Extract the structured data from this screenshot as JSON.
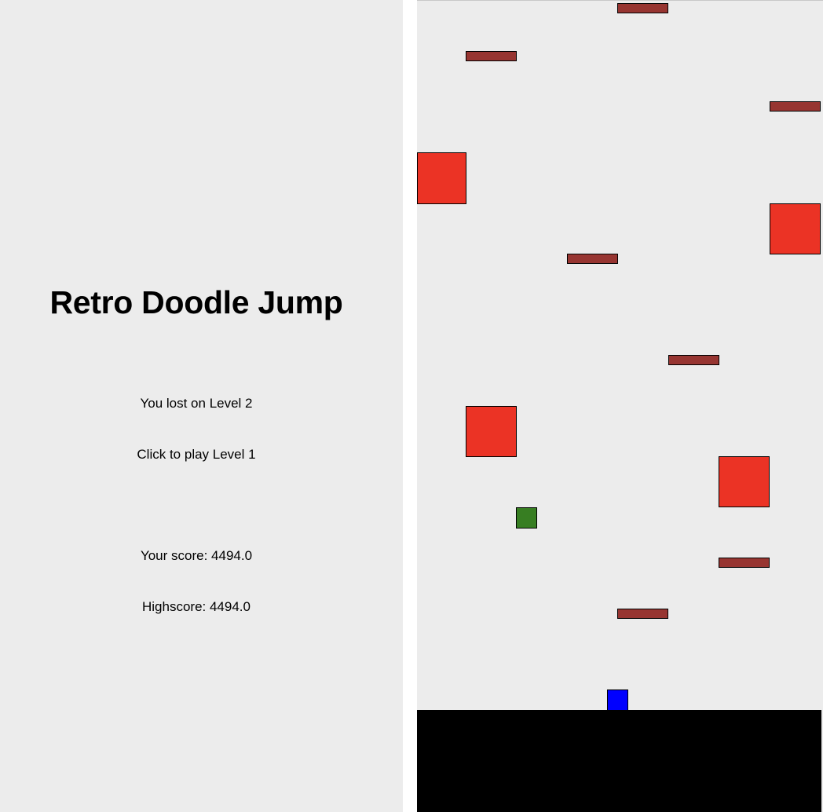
{
  "game": {
    "title": "Retro Doodle Jump",
    "lost_message": "You lost on Level 2",
    "play_prompt": "Click to play Level 1",
    "score_text": "Your score: 4494.0",
    "highscore_text": "Highscore: 4494.0",
    "last_level": 2,
    "next_level": 1,
    "score": 4494.0,
    "highscore": 4494.0
  },
  "colors": {
    "background": "#ececec",
    "platform": "#973531",
    "hazard": "#eb3325",
    "powerup": "#377e22",
    "player": "#0000ff",
    "ground": "#000000"
  }
}
